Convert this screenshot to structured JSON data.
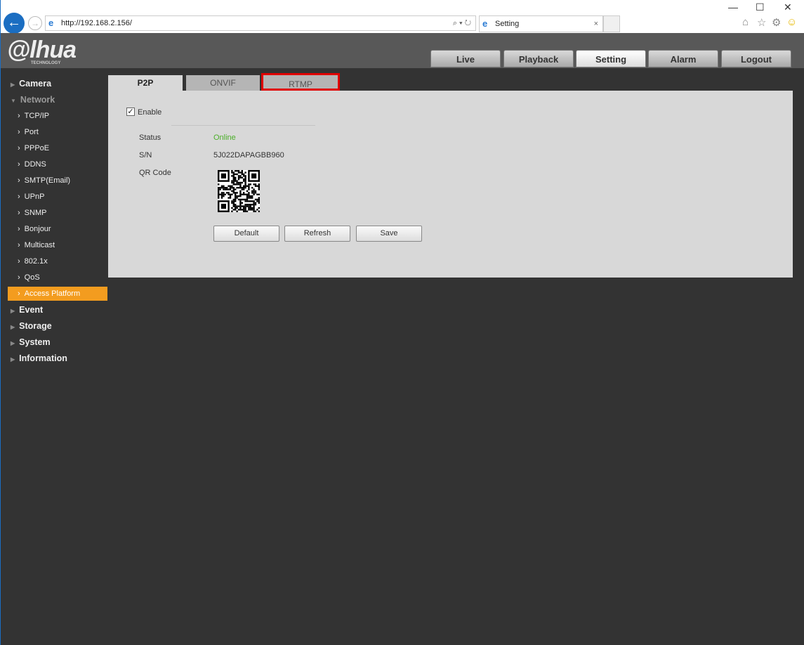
{
  "browser": {
    "url": "http://192.168.2.156/",
    "tab_title": "Setting"
  },
  "header": {
    "logo": "alhua",
    "logo_sub": "TECHNOLOGY",
    "nav": [
      {
        "label": "Live"
      },
      {
        "label": "Playback"
      },
      {
        "label": "Setting",
        "active": true
      },
      {
        "label": "Alarm"
      },
      {
        "label": "Logout"
      }
    ]
  },
  "sidebar": {
    "items": [
      {
        "label": "Camera",
        "level": 0
      },
      {
        "label": "Network",
        "level": 0,
        "expanded": true
      },
      {
        "label": "TCP/IP",
        "level": 1
      },
      {
        "label": "Port",
        "level": 1
      },
      {
        "label": "PPPoE",
        "level": 1
      },
      {
        "label": "DDNS",
        "level": 1
      },
      {
        "label": "SMTP(Email)",
        "level": 1
      },
      {
        "label": "UPnP",
        "level": 1
      },
      {
        "label": "SNMP",
        "level": 1
      },
      {
        "label": "Bonjour",
        "level": 1
      },
      {
        "label": "Multicast",
        "level": 1
      },
      {
        "label": "802.1x",
        "level": 1
      },
      {
        "label": "QoS",
        "level": 1
      },
      {
        "label": "Access Platform",
        "level": 1,
        "selected": true
      },
      {
        "label": "Event",
        "level": 0
      },
      {
        "label": "Storage",
        "level": 0
      },
      {
        "label": "System",
        "level": 0
      },
      {
        "label": "Information",
        "level": 0
      }
    ]
  },
  "tabs": [
    {
      "label": "P2P",
      "active": true
    },
    {
      "label": "ONVIF"
    },
    {
      "label": "RTMP",
      "highlighted": true
    }
  ],
  "p2p": {
    "enable_label": "Enable",
    "enabled": true,
    "status_label": "Status",
    "status_value": "Online",
    "status_color": "#4caf2a",
    "sn_label": "S/N",
    "sn_value": "5J022DAPAGBB960",
    "qr_label": "QR Code",
    "buttons": {
      "default": "Default",
      "refresh": "Refresh",
      "save": "Save"
    }
  },
  "colors": {
    "accent": "#f39c1f",
    "highlight_box": "#e00000"
  }
}
